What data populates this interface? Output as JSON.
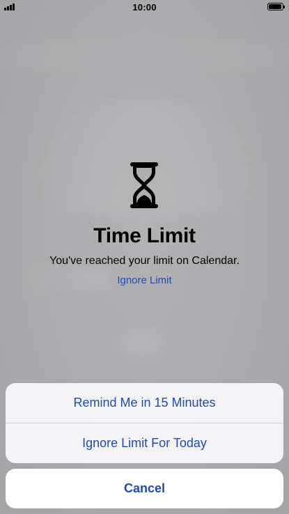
{
  "status_bar": {
    "time": "10:00",
    "signal_icon": "cellular-signal-icon",
    "battery_icon": "battery-full-icon"
  },
  "alert": {
    "icon": "hourglass-icon",
    "title": "Time Limit",
    "message": "You've reached your limit on Calendar.",
    "ignore_link": "Ignore Limit"
  },
  "action_sheet": {
    "options": [
      {
        "label": "Remind Me in 15 Minutes"
      },
      {
        "label": "Ignore Limit For Today"
      }
    ],
    "cancel_label": "Cancel"
  },
  "colors": {
    "accent": "#1e4bb4",
    "overlay": "#aaaaac",
    "sheet_background": "#f6f6f8"
  }
}
